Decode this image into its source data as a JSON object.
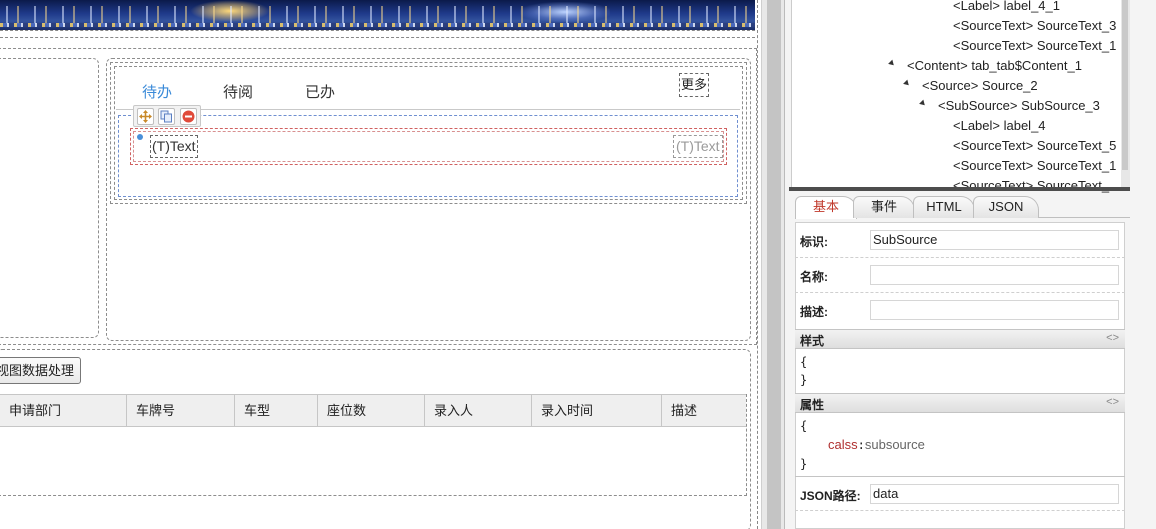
{
  "designer": {
    "tabs": [
      {
        "label": "待办",
        "active": true
      },
      {
        "label": "待阅",
        "active": false
      },
      {
        "label": "已办",
        "active": false
      }
    ],
    "more_label": "更多",
    "item": {
      "text_left": "(T)Text",
      "text_right": "(T)Text"
    },
    "view_button": "视图数据处理",
    "grid_columns": [
      "申请部门",
      "车牌号",
      "车型",
      "座位数",
      "录入人",
      "录入时间",
      "描述"
    ]
  },
  "tree": {
    "rows": [
      {
        "label": "<Label> label_4_1",
        "expanded": false
      },
      {
        "label": "<SourceText> SourceText_3",
        "expanded": false
      },
      {
        "label": "<SourceText> SourceText_1",
        "expanded": false
      },
      {
        "label": "<Content> tab_tab$Content_1",
        "expanded": true
      },
      {
        "label": "<Source> Source_2",
        "expanded": true
      },
      {
        "label": "<SubSource> SubSource_3",
        "expanded": true
      },
      {
        "label": "<Label> label_4",
        "expanded": false
      },
      {
        "label": "<SourceText> SourceText_5",
        "expanded": false
      },
      {
        "label": "<SourceText> SourceText_1",
        "expanded": false
      },
      {
        "label": "<SourceText> SourceText_",
        "expanded": false
      }
    ]
  },
  "properties": {
    "tabs": [
      {
        "label": "基本",
        "active": true
      },
      {
        "label": "事件",
        "active": false
      },
      {
        "label": "HTML",
        "active": false
      },
      {
        "label": "JSON",
        "active": false
      }
    ],
    "fields": {
      "id_label": "标识:",
      "id_value": "SubSource",
      "name_label": "名称:",
      "name_value": "",
      "desc_label": "描述:",
      "desc_value": "",
      "json_path_label": "JSON路径:",
      "json_path_value": "data"
    },
    "style_section": {
      "title": "样式",
      "toggle": "<>",
      "open": "{",
      "close": "}"
    },
    "attr_section": {
      "title": "属性",
      "toggle": "<>",
      "open": "{",
      "key": "calss",
      "sep": ":",
      "value": "subsource",
      "close": "}"
    }
  },
  "colors": {
    "active_tab": "#3a8ad8",
    "active_prop_tab": "#c0392b",
    "attr_key": "#b03030"
  }
}
